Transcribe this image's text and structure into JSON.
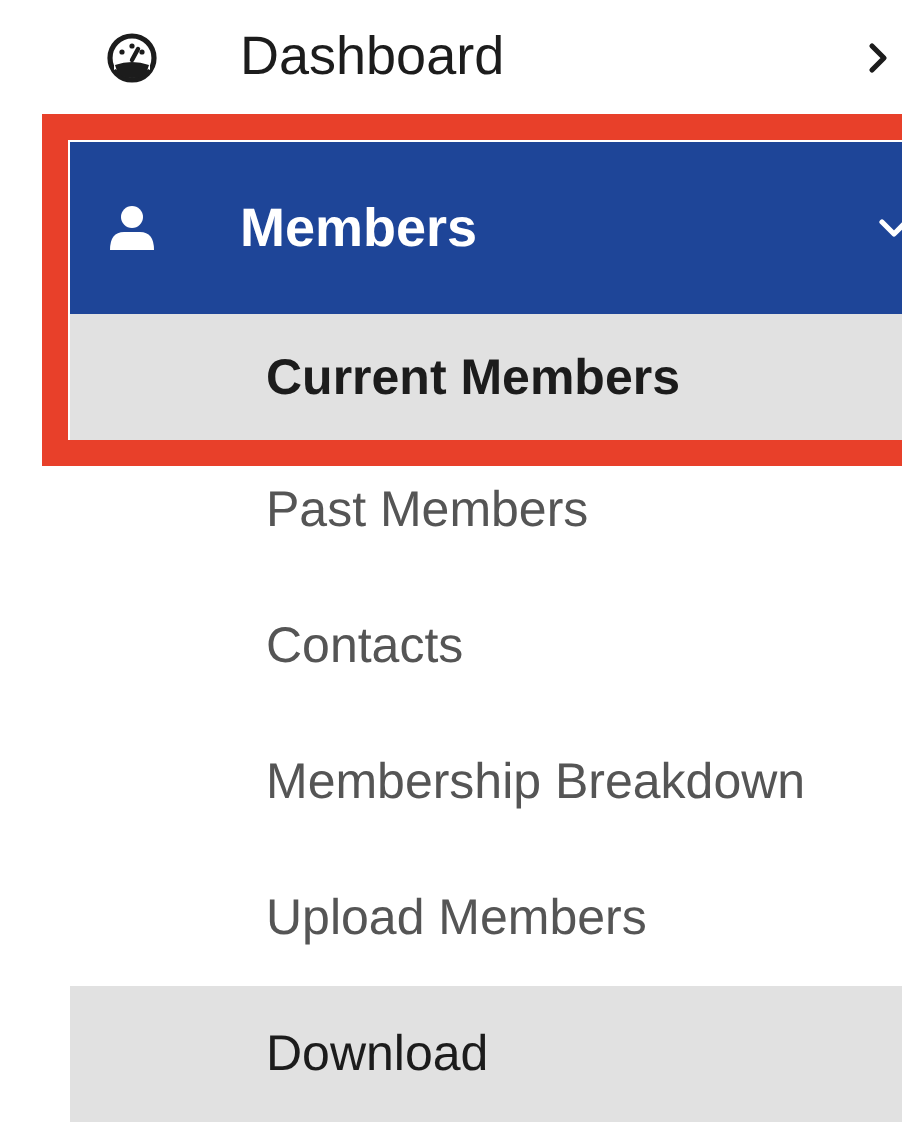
{
  "menu": [
    {
      "label": "Dashboard",
      "kind": "gauge",
      "selected": false,
      "expanded": false,
      "highlighted": false
    },
    {
      "label": "Members",
      "kind": "person",
      "selected": true,
      "expanded": true,
      "highlighted": true,
      "children": [
        {
          "label": "Current Members",
          "selected": true,
          "hovered": false
        },
        {
          "label": "Past Members",
          "selected": false,
          "hovered": false
        },
        {
          "label": "Contacts",
          "selected": false,
          "hovered": false
        },
        {
          "label": "Membership Breakdown",
          "selected": false,
          "hovered": false
        },
        {
          "label": "Upload Members",
          "selected": false,
          "hovered": false
        },
        {
          "label": "Download",
          "selected": false,
          "hovered": true
        }
      ]
    }
  ]
}
